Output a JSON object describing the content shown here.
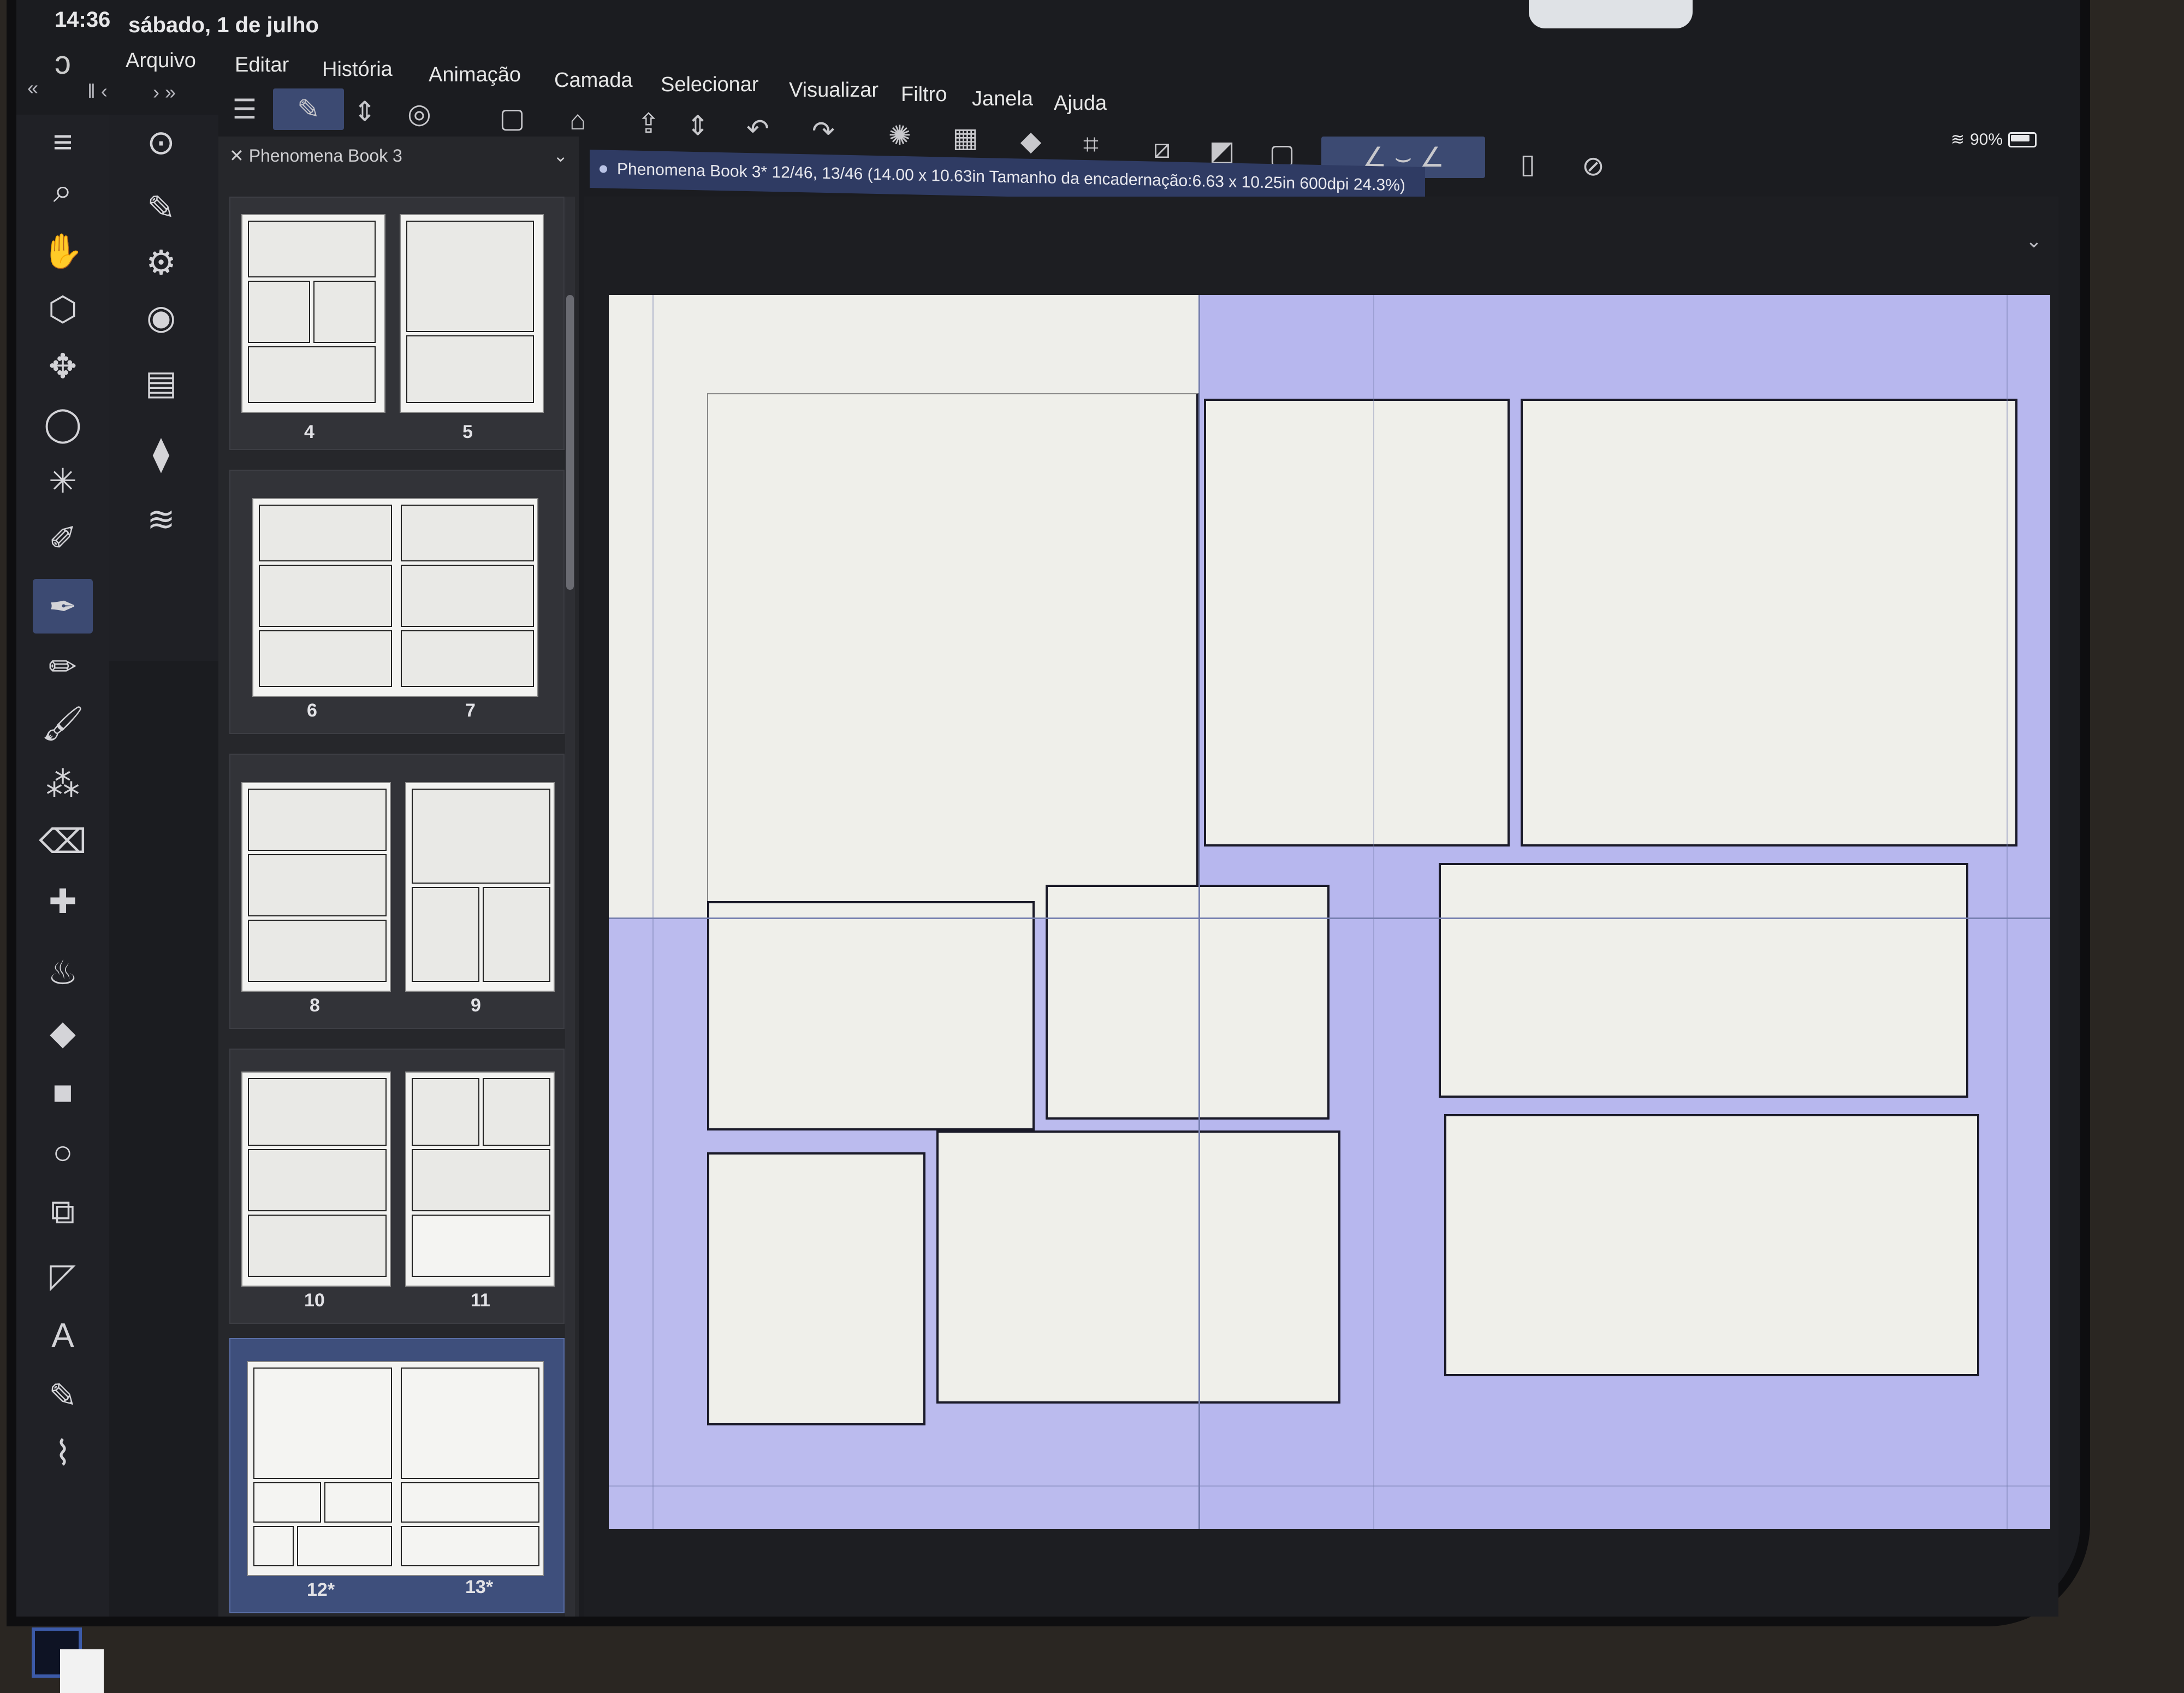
{
  "status": {
    "time": "14:36",
    "date": "sábado, 1 de julho",
    "battery": "90%"
  },
  "menu": {
    "items": [
      "Arquivo",
      "Editar",
      "História",
      "Animação",
      "Camada",
      "Selecionar",
      "Visualizar",
      "Filtro",
      "Janela",
      "Ajuda"
    ]
  },
  "toolbar": {
    "icons": [
      "nav-back-icon",
      "nav-forward-icon",
      "menu-icon",
      "edit-mode-icon",
      "updown-icon",
      "story-icon",
      "new-page-icon",
      "open-icon",
      "export-icon",
      "undo-icon",
      "redo-icon",
      "loading-icon",
      "selection-icon",
      "fill-icon",
      "transform-icon",
      "snap-icon",
      "ruler-icon",
      "frame-icon",
      "stabilizer-icon",
      "smartphone-icon",
      "settings-icon"
    ]
  },
  "tab": {
    "title": "Phenomena Book 3"
  },
  "document": {
    "info": "Phenomena Book 3* 12/46, 13/46 (14.00 x 10.63in Tamanho da encadernação:6.63 x 10.25in 600dpi 24.3%)"
  },
  "pages": {
    "numbers": [
      "4",
      "5",
      "6",
      "7",
      "8",
      "9",
      "10",
      "11",
      "12*",
      "13*"
    ]
  },
  "colors": {
    "accent": "#3c4a72",
    "selection": "#b7b7ee",
    "paper": "#efefea"
  }
}
